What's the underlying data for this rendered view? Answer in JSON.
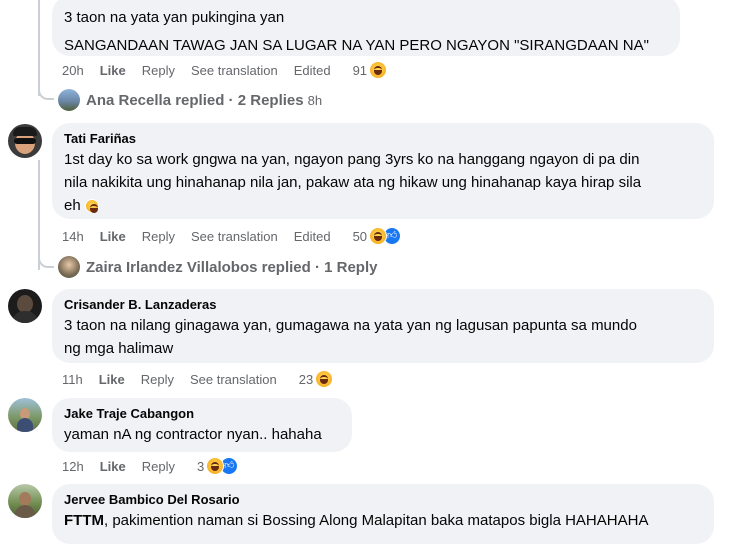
{
  "comments": [
    {
      "lines": [
        "3 taon na yata yan pukingina yan",
        "SANGANDAAN TAWAG JAN SA LUGAR NA YAN PERO NGAYON \"SIRANGDAAN NA\""
      ],
      "time": "20h",
      "like": "Like",
      "reply": "Reply",
      "translate": "See translation",
      "edited": "Edited",
      "count": "91",
      "replied_by": "Ana Recella replied · 2 Replies",
      "replied_time": "8h"
    },
    {
      "author": "Tati Fariñas",
      "lines": [
        "1st day ko sa work gngwa na yan, ngayon pang 3yrs ko na hanggang ngayon di pa din",
        "nila nakikita ung hinahanap nila jan, pakaw ata ng hikaw ung hinahanap kaya hirap sila",
        "eh"
      ],
      "time": "14h",
      "like": "Like",
      "reply": "Reply",
      "translate": "See translation",
      "edited": "Edited",
      "count": "50",
      "replied_by": "Zaira Irlandez Villalobos replied · 1 Reply"
    },
    {
      "author": "Crisander B. Lanzaderas",
      "lines": [
        "3 taon na nilang ginagawa yan, gumagawa na yata yan ng lagusan papunta sa mundo",
        "ng mga halimaw"
      ],
      "time": "11h",
      "like": "Like",
      "reply": "Reply",
      "translate": "See translation",
      "count": "23"
    },
    {
      "author": "Jake Traje Cabangon",
      "lines": [
        "yaman nA ng contractor nyan.. hahaha"
      ],
      "time": "12h",
      "like": "Like",
      "reply": "Reply",
      "count": "3"
    },
    {
      "author": "Jervee Bambico Del Rosario",
      "mention": "FTTM",
      "text_rest": ", pakimention naman si Bossing Along Malapitan baka matapos bigla HAHAHAHA"
    }
  ],
  "icons": [
    "haha-reaction-icon",
    "like-reaction-icon",
    "crying-laughing-emoji-icon"
  ],
  "colors": {
    "bubble": "#f0f2f5",
    "meta": "#65676b",
    "like_blue": "#1877f2",
    "text": "#050505"
  }
}
